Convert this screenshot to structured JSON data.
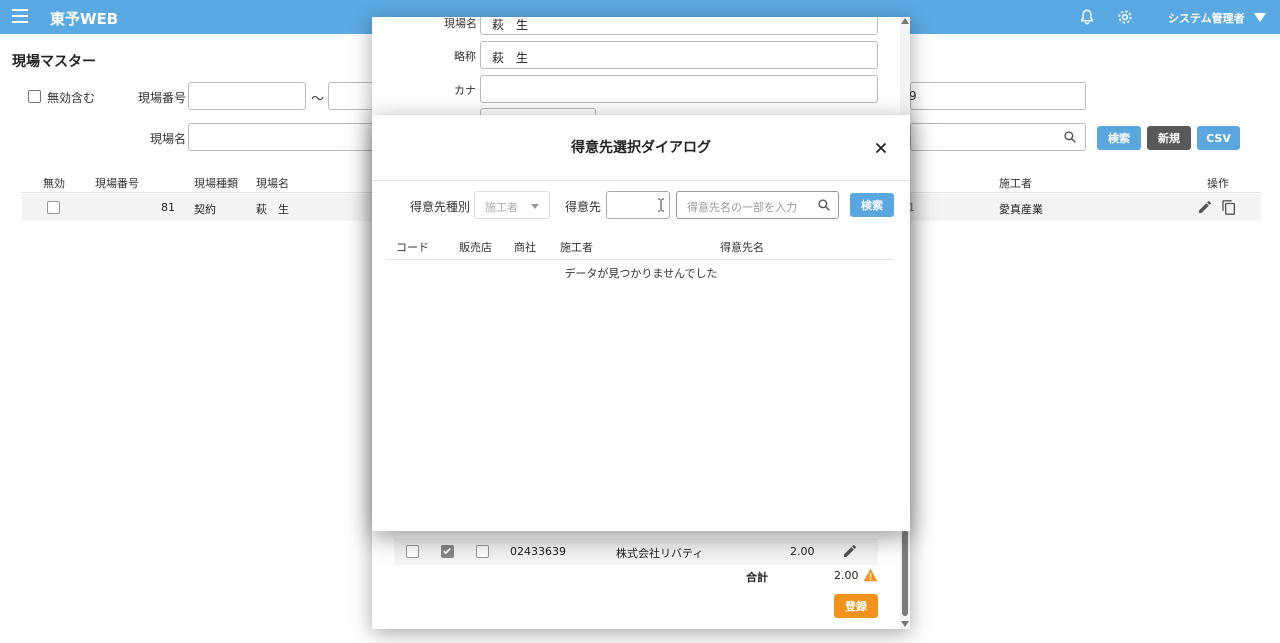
{
  "app": {
    "title": "東予WEB",
    "user": "システム管理者"
  },
  "page": {
    "title": "現場マスター",
    "include_inactive_label": "無効含む",
    "site_no_label": "現場番号",
    "range_sep": "〜",
    "site_no_to_partial": "9",
    "site_name_label": "現場名",
    "search_btn": "検索",
    "new_btn": "新規",
    "csv_btn": "CSV",
    "table": {
      "headers": {
        "inactive": "無効",
        "site_no": "現場番号",
        "site_type": "現場種類",
        "site_name": "現場名",
        "builder": "施工者",
        "ops": "操作"
      },
      "rows": [
        {
          "site_no": "81",
          "site_type": "契約",
          "site_name": "萩　生",
          "partial": "1",
          "builder": "愛真産業"
        }
      ]
    }
  },
  "form": {
    "site_name_label": "現場名",
    "site_name_value": "萩　生",
    "short_label": "略称",
    "short_value": "萩　生",
    "kana_label": "カナ",
    "kana_value": "",
    "row": {
      "code": "02433639",
      "company": "株式会社リバティ",
      "amount": "2.00"
    },
    "total_label": "合計",
    "total_value": "2.00",
    "register_btn": "登録"
  },
  "dialog": {
    "title": "得意先選択ダイアログ",
    "type_label": "得意先種別",
    "type_value": "施工者",
    "customer_label": "得意先",
    "customer_code_value": "",
    "customer_name_placeholder": "得意先名の一部を入力",
    "search_btn": "検索",
    "columns": {
      "code": "コード",
      "dealer": "販売店",
      "trader": "商社",
      "builder": "施工者",
      "customer_name": "得意先名"
    },
    "empty_message": "データが見つかりませんでした"
  },
  "colors": {
    "appbar": "#5ba9e2",
    "accent": "#5aa7e0",
    "register": "#f0921c",
    "warn": "#f0921c"
  }
}
